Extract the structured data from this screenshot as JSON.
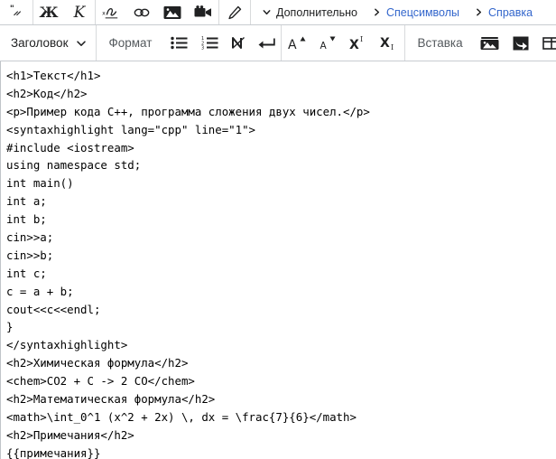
{
  "toolbar_row1": {
    "groups": [
      {
        "name": "citation-group",
        "buttons": [
          {
            "icon": "quote-icon",
            "label": "\"",
            "title": "Цитата"
          }
        ]
      },
      {
        "name": "text-style-group",
        "buttons": [
          {
            "icon": "bold-icon",
            "label": "Ж",
            "title": "Полужирный"
          },
          {
            "icon": "italic-icon",
            "label": "К",
            "title": "Курсив"
          }
        ]
      },
      {
        "name": "insert-group",
        "buttons": [
          {
            "icon": "signature-icon",
            "label": "x",
            "title": "Подпись"
          },
          {
            "icon": "link-icon",
            "label": "link",
            "title": "Ссылка"
          },
          {
            "icon": "image-icon",
            "label": "image",
            "title": "Изображение"
          },
          {
            "icon": "video-icon",
            "label": "video",
            "title": "Видео"
          }
        ]
      },
      {
        "name": "highlight-group",
        "buttons": [
          {
            "icon": "pencil-icon",
            "label": "pencil",
            "title": "Выделение"
          }
        ]
      }
    ],
    "menus": [
      {
        "name": "advanced-menu",
        "label": "Дополнительно",
        "chevron": "chevron-down-icon",
        "link": false
      },
      {
        "name": "special-chars-menu",
        "label": "Спецсимволы",
        "chevron": "chevron-right-icon",
        "link": true
      },
      {
        "name": "help-menu",
        "label": "Справка",
        "chevron": "chevron-right-icon",
        "link": true
      }
    ]
  },
  "toolbar_row2": {
    "heading_dropdown": {
      "label": "Заголовок",
      "caret": "chevron-down-icon"
    },
    "format_label": "Формат",
    "format_buttons": [
      {
        "icon": "bullet-list-icon",
        "title": "Маркированный список"
      },
      {
        "icon": "numbered-list-icon",
        "title": "Нумерованный список"
      },
      {
        "icon": "nowiki-icon",
        "title": "Без вики-разметки"
      },
      {
        "icon": "newline-icon",
        "title": "Перевод строки"
      }
    ],
    "size_buttons": [
      {
        "icon": "increase-font-size-icon",
        "label": "A",
        "title": "Увеличить размер"
      },
      {
        "icon": "decrease-font-size-icon",
        "label": "A",
        "title": "Уменьшить размер"
      },
      {
        "icon": "superscript-icon",
        "label": "X",
        "title": "Верхний индекс"
      },
      {
        "icon": "subscript-icon",
        "label": "X",
        "title": "Нижний индекс"
      }
    ],
    "insert_label": "Вставка",
    "insert_buttons": [
      {
        "icon": "media-icon",
        "title": "Медиафайл"
      },
      {
        "icon": "template-icon",
        "title": "Шаблон"
      },
      {
        "icon": "table-icon",
        "title": "Таблица"
      }
    ]
  },
  "editor": {
    "lines": [
      "<h1>Текст</h1>",
      "<h2>Код</h2>",
      "<p>Пример кода C++, программа сложения двух чисел.</p>",
      "<syntaxhighlight lang=\"cpp\" line=\"1\">",
      "#include <iostream>",
      "using namespace std;",
      "int main()",
      "int a;",
      "int b;",
      "cin>>a;",
      "cin>>b;",
      "int c;",
      "c = a + b;",
      "cout<<c<<endl;",
      "}",
      "</syntaxhighlight>",
      "<h2>Химическая формула</h2>",
      "<chem>CO2 + C -> 2 CO</chem>",
      "<h2>Математическая формула</h2>",
      "<math>\\int_0^1 (x^2 + 2x) \\, dx = \\frac{7}{6}</math>",
      "<h2>Примечания</h2>",
      "{{примечания}}"
    ]
  },
  "colors": {
    "link": "#3366cc",
    "text": "#202122",
    "muted": "#54595d",
    "border": "#c8ccd1",
    "background": "#ffffff"
  }
}
